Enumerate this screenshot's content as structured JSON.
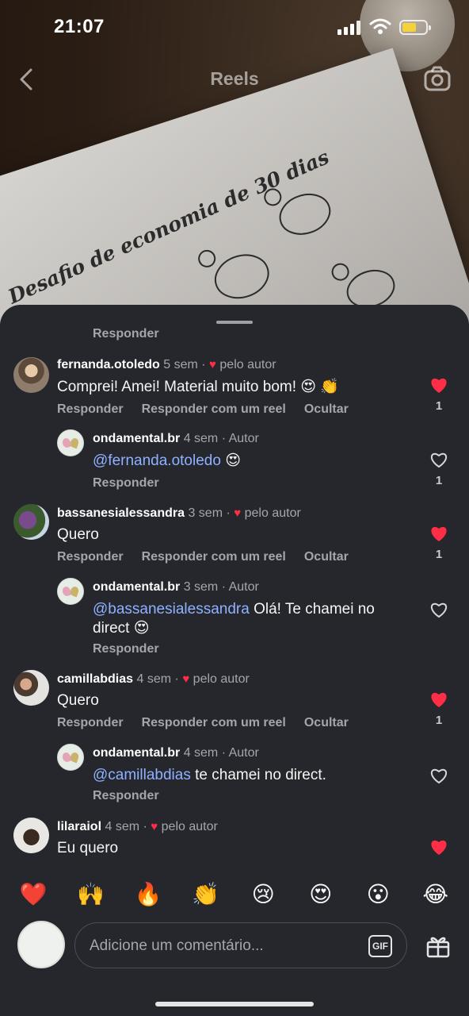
{
  "status_bar": {
    "time": "21:07"
  },
  "header": {
    "title": "Reels"
  },
  "background": {
    "paper_title": "Desafio de economia de 30 dias"
  },
  "sheet": {
    "peek_reply": "Responder",
    "comments": [
      {
        "user": "fernanda.otoledo",
        "age": "5 sem",
        "dot": "·",
        "liked_label": "pelo autor",
        "text": "Comprei! Amei! Material muito bom! 😍 👏",
        "actions": [
          "Responder",
          "Responder com um reel",
          "Ocultar"
        ],
        "likes": "1",
        "liked": true,
        "reply": {
          "user": "ondamental.br",
          "age": "4 sem",
          "dot": "·",
          "role": "Autor",
          "mention": "@fernanda.otoledo",
          "text": " 😍",
          "action": "Responder",
          "likes": "1"
        }
      },
      {
        "user": "bassanesialessandra",
        "age": "3 sem",
        "dot": "·",
        "liked_label": "pelo autor",
        "text": "Quero",
        "actions": [
          "Responder",
          "Responder com um reel",
          "Ocultar"
        ],
        "likes": "1",
        "liked": true,
        "reply": {
          "user": "ondamental.br",
          "age": "3 sem",
          "dot": "·",
          "role": "Autor",
          "mention": "@bassanesialessandra",
          "text": " Olá! Te chamei no direct 😍",
          "action": "Responder",
          "likes": ""
        }
      },
      {
        "user": "camillabdias",
        "age": "4 sem",
        "dot": "·",
        "liked_label": "pelo autor",
        "text": "Quero",
        "actions": [
          "Responder",
          "Responder com um reel",
          "Ocultar"
        ],
        "likes": "1",
        "liked": true,
        "reply": {
          "user": "ondamental.br",
          "age": "4 sem",
          "dot": "·",
          "role": "Autor",
          "mention": "@camillabdias",
          "text": " te chamei no direct.",
          "action": "Responder",
          "likes": ""
        }
      },
      {
        "user": "lilaraiol",
        "age": "4 sem",
        "dot": "·",
        "liked_label": "pelo autor",
        "text": "Eu quero",
        "likes": "",
        "liked": true
      }
    ]
  },
  "quick_reactions": [
    "❤️",
    "🙌",
    "🔥",
    "👏",
    "😢",
    "😍",
    "😮",
    "😂"
  ],
  "composer": {
    "placeholder": "Adicione um comentário...",
    "gif_label": "GIF"
  },
  "icons": {
    "back": "chevron-left-icon",
    "camera": "camera-icon",
    "heart_filled": "heart-filled-icon",
    "heart_outline": "heart-outline-icon",
    "gift": "gift-icon",
    "gif": "gif-icon"
  },
  "colors": {
    "sheet_bg": "#25272d",
    "like_red": "#ff2d45",
    "mention_blue": "#8fb1ff",
    "muted": "#a4a6ab"
  }
}
